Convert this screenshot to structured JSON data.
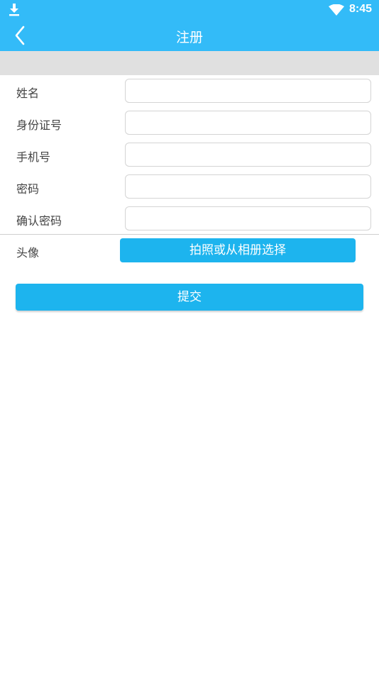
{
  "status_bar": {
    "time": "8:45",
    "icons": [
      "download-icon",
      "wifi-icon"
    ],
    "color": "#33bbf8"
  },
  "app_bar": {
    "title": "注册",
    "back_icon": "chevron-left-icon",
    "color": "#33bbf8"
  },
  "form": {
    "fields": [
      {
        "label": "姓名",
        "value": "",
        "placeholder": ""
      },
      {
        "label": "身份证号",
        "value": "",
        "placeholder": ""
      },
      {
        "label": "手机号",
        "value": "",
        "placeholder": ""
      },
      {
        "label": "密码",
        "value": "",
        "placeholder": ""
      },
      {
        "label": "确认密码",
        "value": "",
        "placeholder": ""
      }
    ],
    "avatar": {
      "label": "头像",
      "button_label": "拍照或从相册选择"
    },
    "submit_label": "提交",
    "button_color": "#1db4ee"
  }
}
